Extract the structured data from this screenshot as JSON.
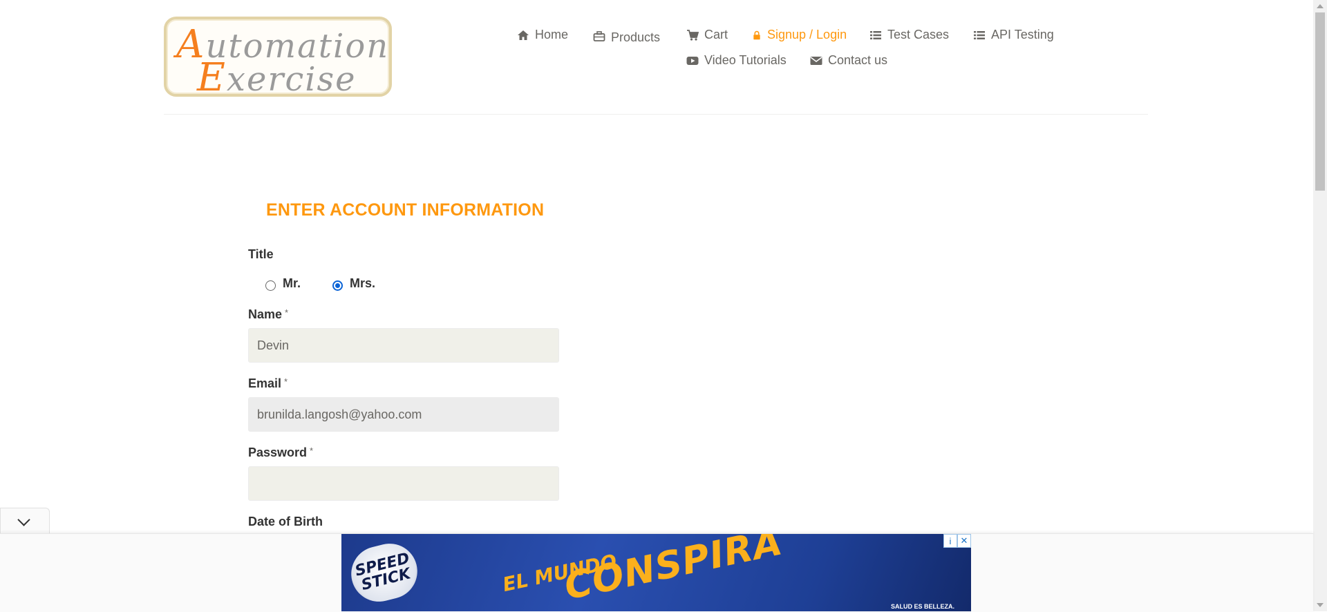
{
  "logo": {
    "line1_cap": "A",
    "line1_rest": "utomation",
    "line2_cap": "E",
    "line2_rest": "xercise"
  },
  "nav": {
    "items": [
      {
        "id": "home",
        "label": "Home",
        "icon": "home-icon"
      },
      {
        "id": "products",
        "label": "Products",
        "icon": "briefcase-icon"
      },
      {
        "id": "cart",
        "label": "Cart",
        "icon": "cart-icon"
      },
      {
        "id": "signup",
        "label": "Signup / Login",
        "icon": "lock-icon",
        "active": true
      },
      {
        "id": "testcases",
        "label": "Test Cases",
        "icon": "list-icon"
      },
      {
        "id": "api",
        "label": "API Testing",
        "icon": "list-icon"
      },
      {
        "id": "video",
        "label": "Video Tutorials",
        "icon": "youtube-icon"
      },
      {
        "id": "contact",
        "label": "Contact us",
        "icon": "envelope-icon"
      }
    ]
  },
  "form": {
    "heading": "ENTER ACCOUNT INFORMATION",
    "title_label": "Title",
    "title_options": [
      {
        "label": "Mr.",
        "checked": false
      },
      {
        "label": "Mrs.",
        "checked": true
      }
    ],
    "required_mark": "*",
    "name": {
      "label": "Name",
      "value": "Devin"
    },
    "email": {
      "label": "Email",
      "value": "brunilda.langosh@yahoo.com"
    },
    "password": {
      "label": "Password",
      "value": ""
    },
    "dob_label": "Date of Birth"
  },
  "ad": {
    "brand": "SPEED STICK",
    "line1": "EL MUNDO",
    "line2": "CONSPIRA",
    "footer": "SALUD ES BELLEZA.",
    "info_symbol": "i",
    "close_symbol": "✕"
  },
  "colors": {
    "accent": "#fe980f",
    "text": "#696763",
    "input_bg": "#f0f0e9",
    "radio_checked": "#0a63d6"
  }
}
